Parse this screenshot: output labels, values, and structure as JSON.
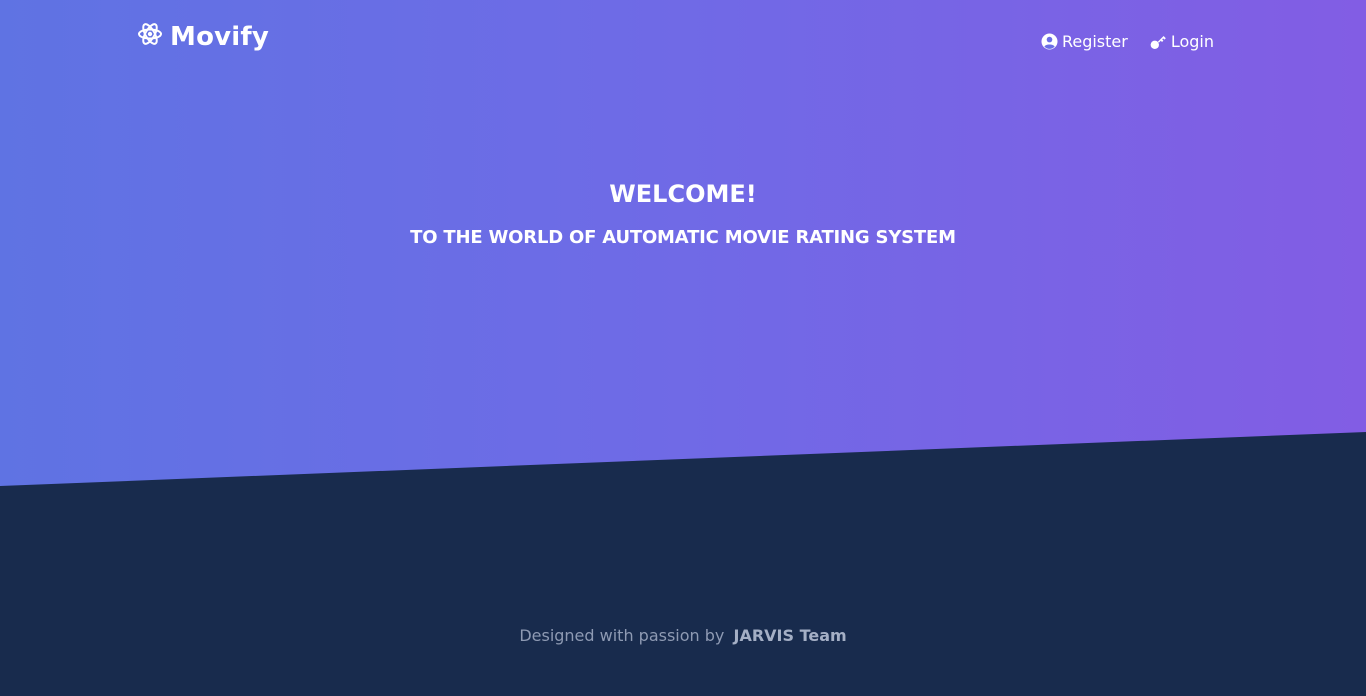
{
  "brand": {
    "name": "Movify",
    "icon": "atom-icon"
  },
  "nav": {
    "register": {
      "label": "Register",
      "icon": "user-circle-icon"
    },
    "login": {
      "label": "Login",
      "icon": "key-icon"
    }
  },
  "hero": {
    "title": "WELCOME!",
    "subtitle": "TO THE WORLD OF AUTOMATIC MOVIE RATING SYSTEM"
  },
  "footer": {
    "text": "Designed with passion by",
    "team": "JARVIS Team"
  },
  "colors": {
    "gradient_start": "#5f73e3",
    "gradient_end": "#825de4",
    "footer_background": "#182b4d",
    "footer_text": "#8e9ab3"
  }
}
